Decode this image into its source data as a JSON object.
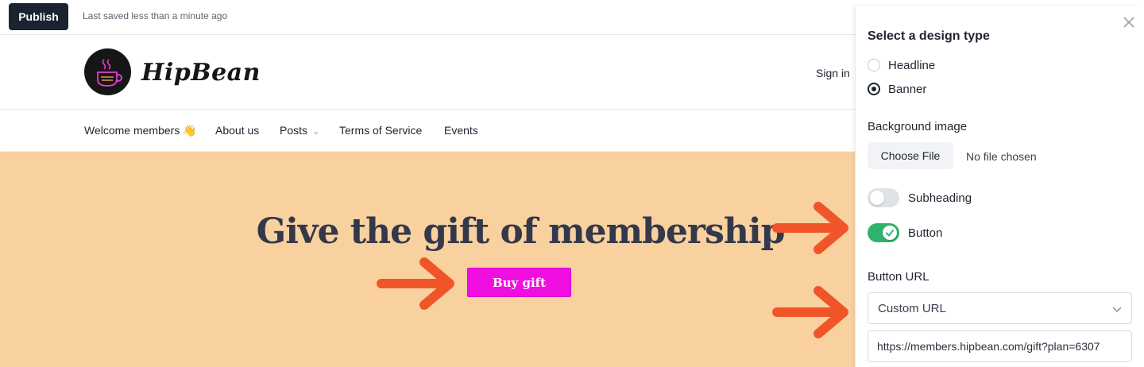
{
  "topbar": {
    "publish_label": "Publish",
    "saved_text": "Last saved less than a minute ago"
  },
  "site": {
    "logo_text": "HipBean",
    "signin_label": "Sign in"
  },
  "nav": {
    "items": [
      "Welcome members 👋",
      "About us",
      "Posts",
      "Terms of Service",
      "Events"
    ]
  },
  "banner": {
    "title": "Give the gift of membership",
    "button_label": "Buy gift",
    "background_color": "#f8d19f",
    "button_color": "#f00ee1"
  },
  "panel": {
    "title": "Select a design type",
    "design_types": [
      {
        "label": "Headline",
        "selected": false
      },
      {
        "label": "Banner",
        "selected": true
      }
    ],
    "background_image_label": "Background image",
    "choose_file_label": "Choose File",
    "no_file_text": "No file chosen",
    "subheading_label": "Subheading",
    "subheading_on": false,
    "button_toggle_label": "Button",
    "button_on": true,
    "button_url_label": "Button URL",
    "url_type_value": "Custom URL",
    "url_value": "https://members.hipbean.com/gift?plan=6307"
  },
  "annotations": {
    "arrow_color": "#f0552a"
  }
}
